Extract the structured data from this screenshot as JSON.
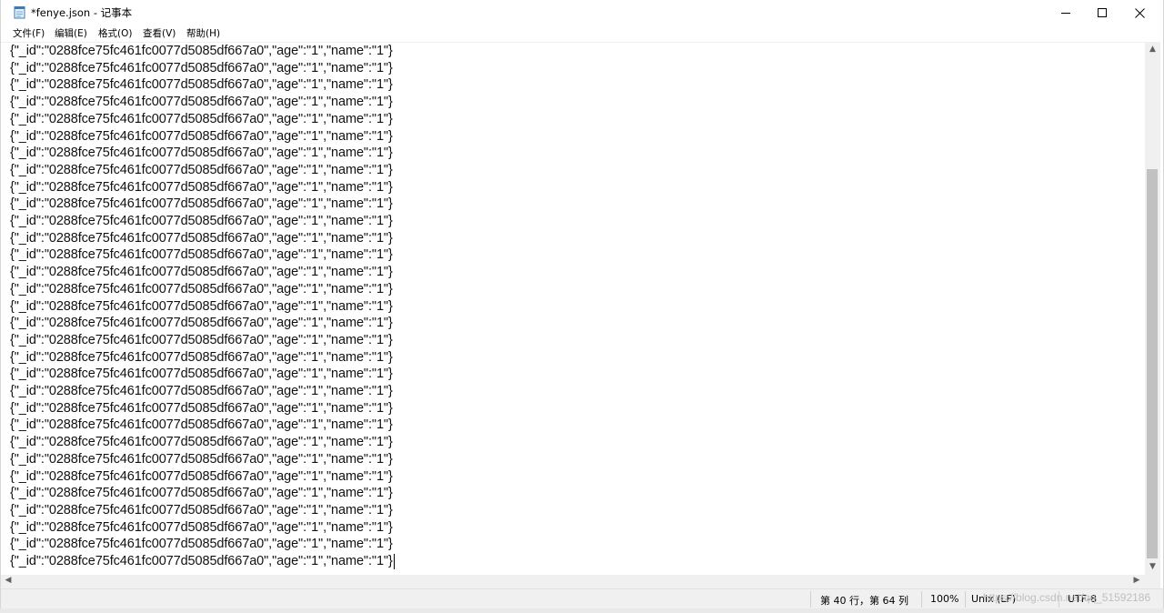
{
  "window": {
    "title": "*fenye.json - 记事本",
    "icon": "notepad-icon"
  },
  "menu": [
    {
      "label": "文件(F)"
    },
    {
      "label": "编辑(E)"
    },
    {
      "label": "格式(O)"
    },
    {
      "label": "查看(V)"
    },
    {
      "label": "帮助(H)"
    }
  ],
  "editor": {
    "lines": [
      "{\"_id\":\"0288fce75fc461fc0077d5085df667a0\",\"age\":\"1\",\"name\":\"1\"}",
      "{\"_id\":\"0288fce75fc461fc0077d5085df667a0\",\"age\":\"1\",\"name\":\"1\"}",
      "{\"_id\":\"0288fce75fc461fc0077d5085df667a0\",\"age\":\"1\",\"name\":\"1\"}",
      "{\"_id\":\"0288fce75fc461fc0077d5085df667a0\",\"age\":\"1\",\"name\":\"1\"}",
      "{\"_id\":\"0288fce75fc461fc0077d5085df667a0\",\"age\":\"1\",\"name\":\"1\"}",
      "{\"_id\":\"0288fce75fc461fc0077d5085df667a0\",\"age\":\"1\",\"name\":\"1\"}",
      "{\"_id\":\"0288fce75fc461fc0077d5085df667a0\",\"age\":\"1\",\"name\":\"1\"}",
      "{\"_id\":\"0288fce75fc461fc0077d5085df667a0\",\"age\":\"1\",\"name\":\"1\"}",
      "{\"_id\":\"0288fce75fc461fc0077d5085df667a0\",\"age\":\"1\",\"name\":\"1\"}",
      "{\"_id\":\"0288fce75fc461fc0077d5085df667a0\",\"age\":\"1\",\"name\":\"1\"}",
      "{\"_id\":\"0288fce75fc461fc0077d5085df667a0\",\"age\":\"1\",\"name\":\"1\"}",
      "{\"_id\":\"0288fce75fc461fc0077d5085df667a0\",\"age\":\"1\",\"name\":\"1\"}",
      "{\"_id\":\"0288fce75fc461fc0077d5085df667a0\",\"age\":\"1\",\"name\":\"1\"}",
      "{\"_id\":\"0288fce75fc461fc0077d5085df667a0\",\"age\":\"1\",\"name\":\"1\"}",
      "{\"_id\":\"0288fce75fc461fc0077d5085df667a0\",\"age\":\"1\",\"name\":\"1\"}",
      "{\"_id\":\"0288fce75fc461fc0077d5085df667a0\",\"age\":\"1\",\"name\":\"1\"}",
      "{\"_id\":\"0288fce75fc461fc0077d5085df667a0\",\"age\":\"1\",\"name\":\"1\"}",
      "{\"_id\":\"0288fce75fc461fc0077d5085df667a0\",\"age\":\"1\",\"name\":\"1\"}",
      "{\"_id\":\"0288fce75fc461fc0077d5085df667a0\",\"age\":\"1\",\"name\":\"1\"}",
      "{\"_id\":\"0288fce75fc461fc0077d5085df667a0\",\"age\":\"1\",\"name\":\"1\"}",
      "{\"_id\":\"0288fce75fc461fc0077d5085df667a0\",\"age\":\"1\",\"name\":\"1\"}",
      "{\"_id\":\"0288fce75fc461fc0077d5085df667a0\",\"age\":\"1\",\"name\":\"1\"}",
      "{\"_id\":\"0288fce75fc461fc0077d5085df667a0\",\"age\":\"1\",\"name\":\"1\"}",
      "{\"_id\":\"0288fce75fc461fc0077d5085df667a0\",\"age\":\"1\",\"name\":\"1\"}",
      "{\"_id\":\"0288fce75fc461fc0077d5085df667a0\",\"age\":\"1\",\"name\":\"1\"}",
      "{\"_id\":\"0288fce75fc461fc0077d5085df667a0\",\"age\":\"1\",\"name\":\"1\"}",
      "{\"_id\":\"0288fce75fc461fc0077d5085df667a0\",\"age\":\"1\",\"name\":\"1\"}",
      "{\"_id\":\"0288fce75fc461fc0077d5085df667a0\",\"age\":\"1\",\"name\":\"1\"}",
      "{\"_id\":\"0288fce75fc461fc0077d5085df667a0\",\"age\":\"1\",\"name\":\"1\"}",
      "{\"_id\":\"0288fce75fc461fc0077d5085df667a0\",\"age\":\"1\",\"name\":\"1\"}",
      "{\"_id\":\"0288fce75fc461fc0077d5085df667a0\",\"age\":\"1\",\"name\":\"1\"}"
    ]
  },
  "statusbar": {
    "position": "第 40 行，第 64 列",
    "zoom": "100%",
    "line_ending": "Unix (LF)",
    "encoding": "UTF-8"
  },
  "watermark": "https://blog.csdn.net/qq_51592186",
  "colors": {
    "statusbar_bg": "#f0f0f0",
    "scroll_thumb": "#c1c1c1"
  }
}
